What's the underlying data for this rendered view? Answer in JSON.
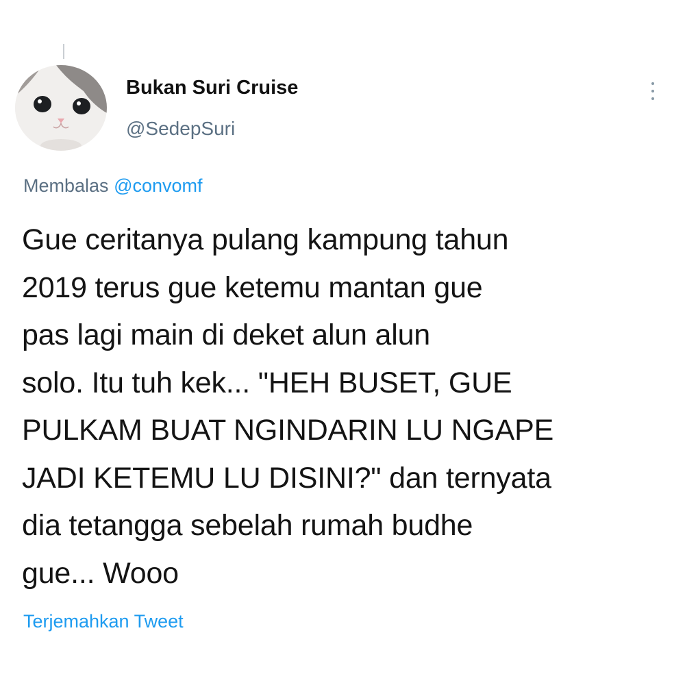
{
  "tweet": {
    "author": {
      "display_name": "Bukan Suri Cruise",
      "handle": "@SedepSuri",
      "avatar_icon": "cat-avatar"
    },
    "replying_to": {
      "prefix": "Membalas",
      "mention": "@convomf"
    },
    "text": "Gue ceritanya pulang kampung tahun\n2019 terus gue ketemu mantan gue\npas lagi main di deket alun alun\nsolo. Itu tuh kek... \"HEH BUSET, GUE\nPULKAM BUAT NGINDARIN LU NGAPE\nJADI KETEMU LU DISINI?\" dan ternyata\ndia tetangga sebelah rumah budhe\ngue... Wooo",
    "translate_label": "Terjemahkan Tweet",
    "more_icon": "more-vertical-icon"
  },
  "colors": {
    "link": "#1d9bf0",
    "secondary_text": "#5b7083",
    "primary_text": "#141414"
  }
}
